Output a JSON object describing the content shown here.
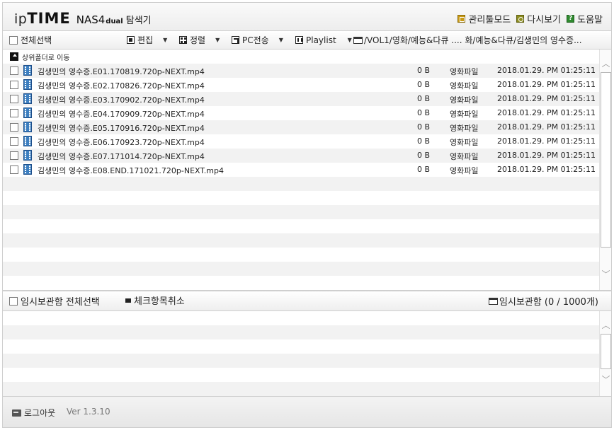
{
  "header": {
    "logo_ip": "ip",
    "logo_time": "TIME",
    "model": "NAS4",
    "model_suffix": "dual",
    "title": "탐색기",
    "links": {
      "admin": "관리툴모드",
      "reload": "다시보기",
      "help": "도움말"
    }
  },
  "toolbar": {
    "select_all": "전체선택",
    "edit": "편집",
    "sort": "정렬",
    "pc_transfer": "PC전송",
    "playlist": "Playlist",
    "path": "/VOL1/영화/예능&다큐 .... 화/예능&다큐/김생민의 영수증..."
  },
  "file_list": {
    "up_folder": "상위폴더로 이동",
    "files": [
      {
        "name": "김생민의 영수증.E01.170819.720p-NEXT.mp4",
        "size": "0 B",
        "type": "영화파일",
        "date": "2018.01.29. PM 01:25:11"
      },
      {
        "name": "김생민의 영수증.E02.170826.720p-NEXT.mp4",
        "size": "0 B",
        "type": "영화파일",
        "date": "2018.01.29. PM 01:25:11"
      },
      {
        "name": "김생민의 영수증.E03.170902.720p-NEXT.mp4",
        "size": "0 B",
        "type": "영화파일",
        "date": "2018.01.29. PM 01:25:11"
      },
      {
        "name": "김생민의 영수증.E04.170909.720p-NEXT.mp4",
        "size": "0 B",
        "type": "영화파일",
        "date": "2018.01.29. PM 01:25:11"
      },
      {
        "name": "김생민의 영수증.E05.170916.720p-NEXT.mp4",
        "size": "0 B",
        "type": "영화파일",
        "date": "2018.01.29. PM 01:25:11"
      },
      {
        "name": "김생민의 영수증.E06.170923.720p-NEXT.mp4",
        "size": "0 B",
        "type": "영화파일",
        "date": "2018.01.29. PM 01:25:11"
      },
      {
        "name": "김생민의 영수증.E07.171014.720p-NEXT.mp4",
        "size": "0 B",
        "type": "영화파일",
        "date": "2018.01.29. PM 01:25:11"
      },
      {
        "name": "김생민의 영수증.E08.END.171021.720p-NEXT.mp4",
        "size": "0 B",
        "type": "영화파일",
        "date": "2018.01.29. PM 01:25:11"
      }
    ]
  },
  "temp_storage": {
    "select_all": "임시보관함 전체선택",
    "uncheck": "체크항목취소",
    "label": "임시보관함 (0 / 1000개)"
  },
  "footer": {
    "logout": "로그아웃",
    "version": "Ver 1.3.10"
  },
  "colors": {
    "admin_icon": "#c89a15",
    "reload_icon": "#8d8d20",
    "help_icon": "#2f8a2f",
    "video_icon": "#3d7fc0"
  },
  "icons": [
    "admin-icon",
    "reload-icon",
    "help-icon",
    "edit-icon",
    "sort-icon",
    "pc-transfer-icon",
    "playlist-icon",
    "folder-icon",
    "up-folder-icon",
    "video-file-icon",
    "uncheck-icon",
    "logout-key-icon"
  ]
}
